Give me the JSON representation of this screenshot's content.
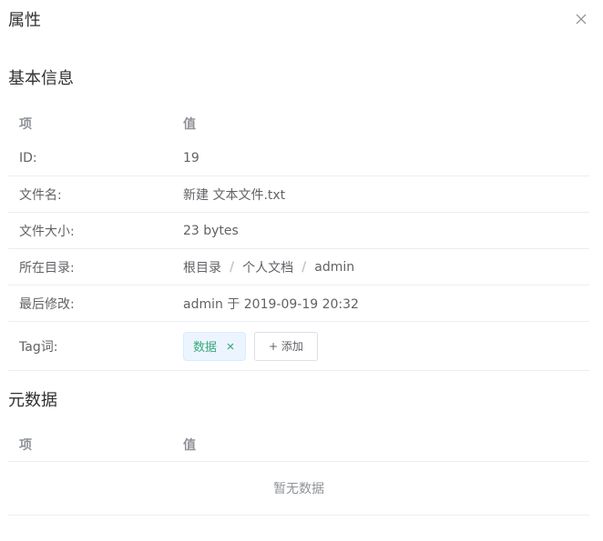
{
  "dialog": {
    "title": "属性"
  },
  "basic": {
    "title": "基本信息",
    "col_key": "项",
    "col_val": "值",
    "id_label": "ID:",
    "id_value": "19",
    "filename_label": "文件名:",
    "filename_value": "新建 文本文件.txt",
    "size_label": "文件大小:",
    "size_value": "23 bytes",
    "dir_label": "所在目录:",
    "dir_path": [
      "根目录",
      "个人文档",
      "admin"
    ],
    "dir_sep": "/",
    "modified_label": "最后修改:",
    "modified_value": "admin 于 2019-09-19 20:32",
    "tag_label": "Tag词:",
    "tags": [
      "数据"
    ],
    "add_tag_label": "+ 添加"
  },
  "meta": {
    "title": "元数据",
    "col_key": "项",
    "col_val": "值",
    "empty_text": "暂无数据"
  },
  "colors": {
    "tag_text": "#39a97b",
    "tag_bg": "#ecf5ff",
    "border": "#ebeef5"
  }
}
